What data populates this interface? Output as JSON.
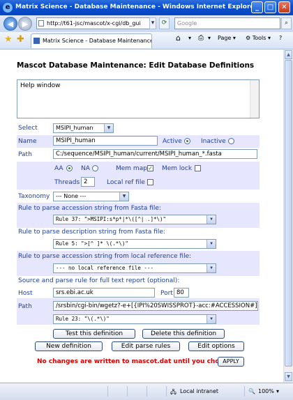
{
  "window": {
    "title": "Matrix Science - Database Maintenance - Windows Internet Explorer",
    "address": "http://t61-jsc/mascot/x-cgi/db_gui",
    "search_placeholder": "Google",
    "tab_title": "Matrix Science - Database Maintenance",
    "cmd_page": "Page",
    "cmd_tools": "Tools"
  },
  "page": {
    "heading": "Mascot Database Maintenance: Edit Database Definitions",
    "help_text": "Help window",
    "labels": {
      "select": "Select",
      "name": "Name",
      "active": "Active",
      "inactive": "Inactive",
      "path": "Path",
      "aa": "AA",
      "na": "NA",
      "mem_map": "Mem map",
      "mem_lock": "Mem lock",
      "threads": "Threads",
      "local_ref_file": "Local ref file",
      "taxonomy": "Taxonomy",
      "rule_accession": "Rule to parse accession string from Fasta file:",
      "rule_description": "Rule to parse description string from Fasta file:",
      "rule_local_ref": "Rule to parse accession string from local reference file:",
      "source_full_text": "Source and parse rule for full text report (optional):",
      "host": "Host",
      "port": "Port",
      "path2": "Path"
    },
    "values": {
      "select": "MSIPI_human",
      "name": "MSIPI_human",
      "path": "C:/sequence/MSIPI_human/current/MSIPI_human_*.fasta",
      "threads": "2",
      "taxonomy": "--- None ---",
      "rule_accession": "Rule 37: \">MSIPI:s*p*|*\\([^| .]*\\)\"",
      "rule_description": "Rule 5: \">[^ ]* \\(.*\\)\"",
      "rule_local_ref": "--- no local reference file ---",
      "host": "srs.ebi.ac.uk",
      "port": "80",
      "report_path": "/srsbin/cgi-bin/wgetz?-e+[{IPI%20SWISSPROT}-acc:#ACCESSION#]",
      "report_rule": "Rule 23: \"\\(.*\\)\""
    },
    "buttons": {
      "test": "Test this definition",
      "delete": "Delete this definition",
      "new": "New definition",
      "edit_rules": "Edit parse rules",
      "edit_options": "Edit options",
      "apply": "APPLY"
    },
    "warning": "No changes are written to mascot.dat until you choose:"
  },
  "status": {
    "zone": "Local intranet",
    "zoom": "100%"
  }
}
